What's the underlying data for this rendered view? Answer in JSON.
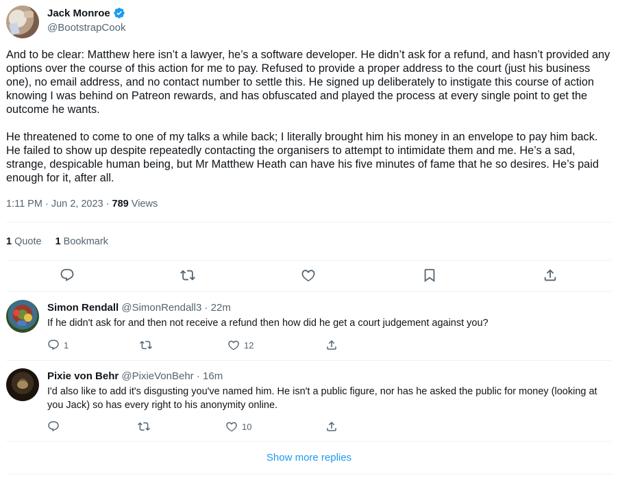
{
  "tweet": {
    "author_name": "Jack Monroe",
    "author_handle": "@BootstrapCook",
    "verified": true,
    "paragraphs": [
      "And to be clear: Matthew here isn’t a lawyer, he’s a software developer. He didn’t ask for a refund, and hasn’t provided any options over the course of this action for me to pay. Refused to provide a proper address to the court (just his business one), no email address, and no contact number to settle this. He signed up deliberately to instigate this course of action knowing I was behind on Patreon rewards, and has obfuscated and played the process at every single point to get the outcome he wants.",
      "He threatened to come to one of my talks a while back; I literally brought him his money in an envelope to pay him back. He failed to show up despite repeatedly contacting the organisers to attempt to intimidate them and me. He’s a sad, strange, despicable human being, but Mr Matthew Heath can have his five minutes of fame that he so desires. He’s paid enough for it, after all."
    ],
    "time": "1:11 PM",
    "sep": "·",
    "date": "Jun 2, 2023",
    "views_count": "789",
    "views_label": "Views",
    "quote_count": "1",
    "quote_label": "Quote",
    "bookmark_count": "1",
    "bookmark_label": "Bookmark",
    "actions": [
      "reply-icon",
      "retweet-icon",
      "like-icon",
      "bookmark-icon",
      "share-icon"
    ]
  },
  "replies": [
    {
      "name": "Simon Rendall",
      "handle": "@SimonRendall3",
      "sep": "·",
      "time": "22m",
      "text": "If he didn't ask for and then not receive a refund then how did he get a court judgement against you?",
      "reply_count": "1",
      "like_count": "12"
    },
    {
      "name": "Pixie von Behr",
      "handle": "@PixieVonBehr",
      "sep": "·",
      "time": "16m",
      "text": "I'd also like to add it's disgusting you've named him. He isn't a public figure, nor has he asked the public for money (looking at you Jack) so has every right to his anonymity online.",
      "reply_count": "",
      "like_count": "10"
    }
  ],
  "show_more": "Show more replies",
  "colors": {
    "accent": "#1d9bf0",
    "muted": "#536471",
    "text": "#0f1419",
    "divider": "#eff3f4"
  }
}
